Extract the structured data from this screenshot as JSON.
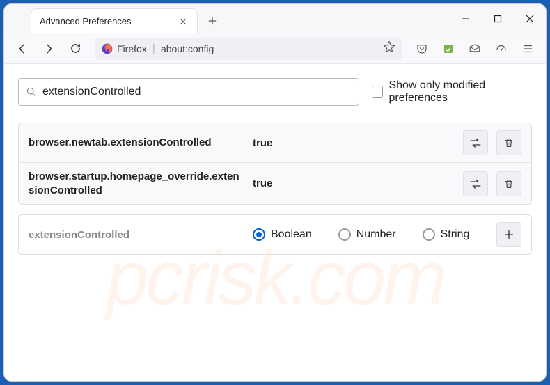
{
  "titlebar": {
    "tab_title": "Advanced Preferences"
  },
  "toolbar": {
    "brand": "Firefox",
    "url": "about:config"
  },
  "search": {
    "value": "extensionControlled",
    "checkbox_label": "Show only modified preferences"
  },
  "preferences": [
    {
      "name": "browser.newtab.extensionControlled",
      "value": "true"
    },
    {
      "name": "browser.startup.homepage_override.extensionControlled",
      "value": "true"
    }
  ],
  "new_pref": {
    "name": "extensionControlled",
    "types": [
      "Boolean",
      "Number",
      "String"
    ],
    "selected": "Boolean"
  },
  "watermark": "pcrisk.com"
}
